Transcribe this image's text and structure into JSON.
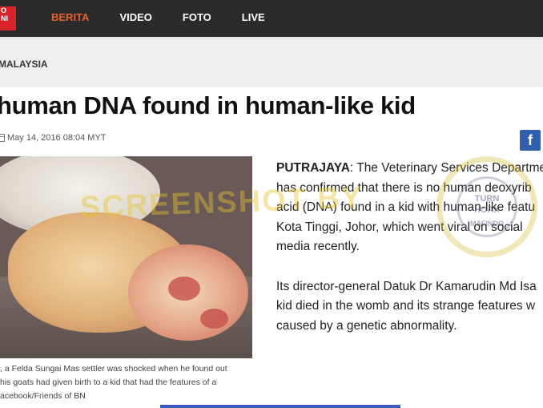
{
  "header": {
    "logo_line1": "O",
    "logo_line2": "NI",
    "nav": [
      "BERITA",
      "VIDEO",
      "FOTO",
      "LIVE"
    ]
  },
  "section": "MALAYSIA",
  "article": {
    "headline": "human DNA found in human-like kid",
    "date": "May 14, 2016 08:04 MYT",
    "photo_caption": [
      ", a Felda Sungai Mas settler was shocked when he found out",
      "his goats had given birth to a kid that had the features of a",
      "acebook/Friends of BN"
    ],
    "dateline": "PUTRAJAYA",
    "p1_lines": [
      ": The Veterinary Services Departme",
      "has confirmed that there is no human deoxyrib",
      "acid (DNA) found in a kid with human-like featu",
      "Kota Tinggi, Johor, which went viral on social",
      "media recently."
    ],
    "p2_lines": [
      "Its director-general Datuk Dr Kamarudin Md Isa",
      "kid died in the womb and its strange features w",
      "caused by a genetic abnormality."
    ]
  },
  "social": {
    "facebook_label": "f"
  },
  "watermark": {
    "text": "SCREENSHOT BY",
    "badge_line1": "TURN",
    "badge_line2": "HOAX",
    "badge_line3": "MAFINDO"
  },
  "colors": {
    "nav_bg": "#2b2b2b",
    "nav_active": "#e8612c",
    "logo_red": "#d8232a",
    "facebook": "#2f5fae",
    "section_bg": "#efefef"
  }
}
